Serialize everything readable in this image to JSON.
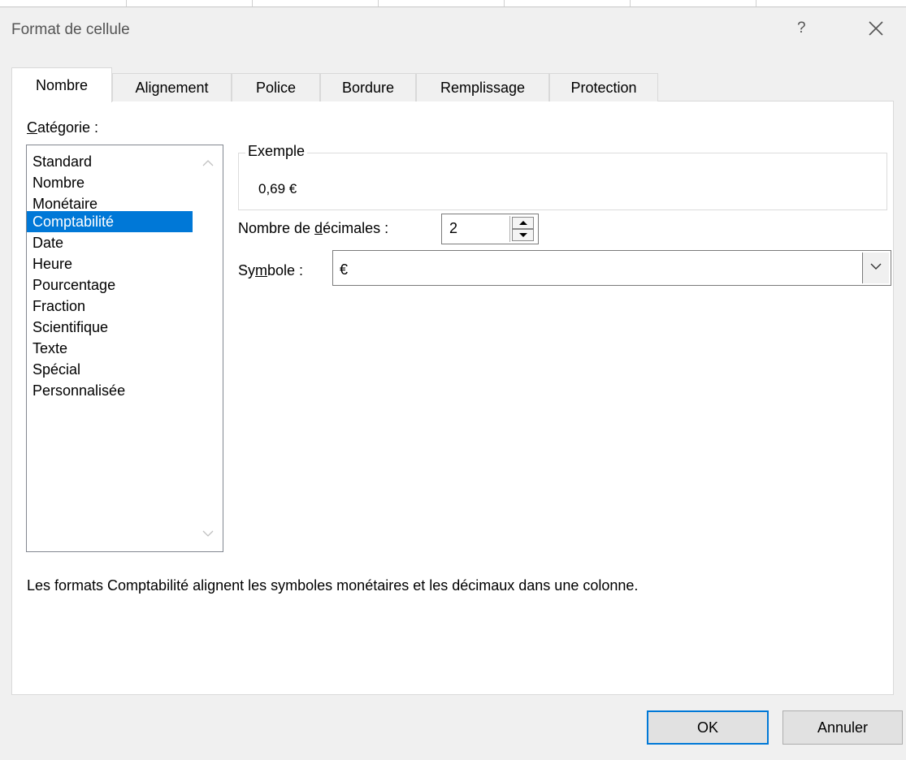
{
  "dialog": {
    "title": "Format de cellule",
    "help_label": "?",
    "close_icon": "close-icon"
  },
  "tabs": [
    {
      "label": "Nombre",
      "active": true
    },
    {
      "label": "Alignement",
      "active": false
    },
    {
      "label": "Police",
      "active": false
    },
    {
      "label": "Bordure",
      "active": false
    },
    {
      "label": "Remplissage",
      "active": false
    },
    {
      "label": "Protection",
      "active": false
    }
  ],
  "category": {
    "label_accel": "C",
    "label_rest": "atégorie :",
    "items": [
      "Standard",
      "Nombre",
      "Monétaire",
      "Comptabilité",
      "Date",
      "Heure",
      "Pourcentage",
      "Fraction",
      "Scientifique",
      "Texte",
      "Spécial",
      "Personnalisée"
    ],
    "selected": "Comptabilité"
  },
  "example": {
    "legend": "Exemple",
    "value": "0,69 €"
  },
  "decimals": {
    "label_before": "Nombre de ",
    "label_accel": "d",
    "label_after": "écimales :",
    "value": "2"
  },
  "symbol": {
    "label_before": "Sy",
    "label_accel": "m",
    "label_after": "bole :",
    "value": "€"
  },
  "description": "Les formats Comptabilité alignent les symboles monétaires et les décimaux dans une colonne.",
  "buttons": {
    "ok": "OK",
    "cancel": "Annuler"
  },
  "colors": {
    "selection": "#0078d7",
    "dialog_bg": "#f0f0f0"
  }
}
